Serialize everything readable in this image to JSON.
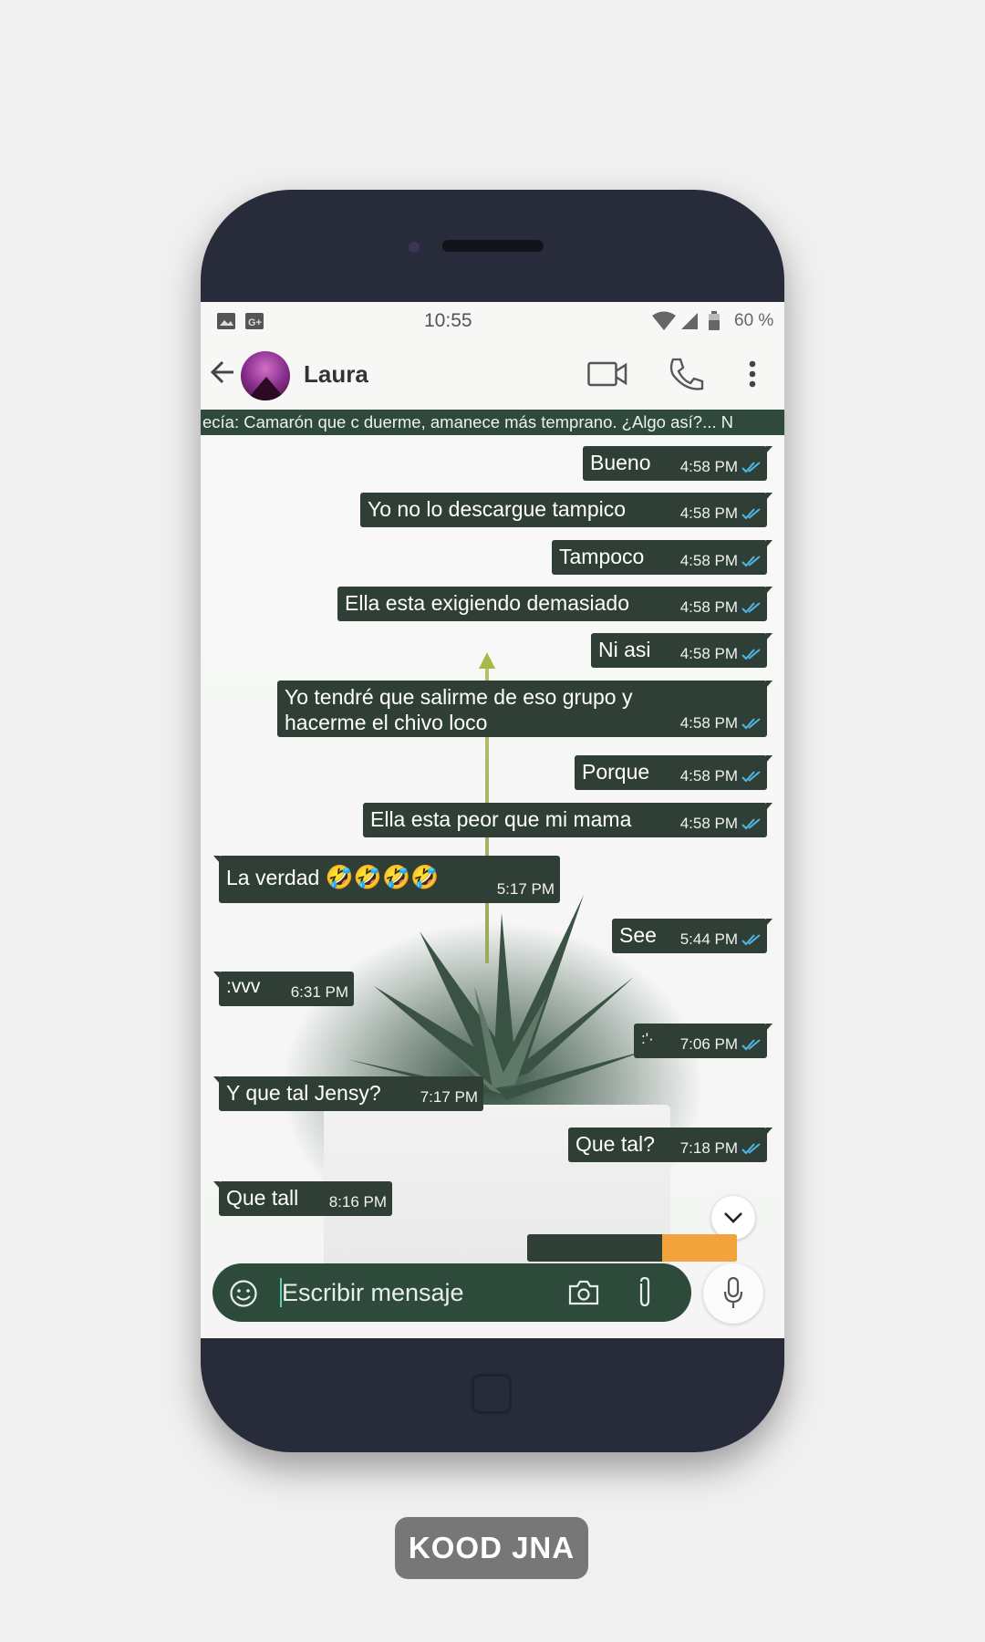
{
  "status_bar": {
    "time": "10:55",
    "battery": "60 %"
  },
  "header": {
    "contact_name": "Laura"
  },
  "marquee_text": "ecía: Camarón que c duerme, amanece más temprano. ¿Algo así?... N",
  "messages": [
    {
      "text": "Bueno",
      "time": "4:58 PM",
      "dir": "out"
    },
    {
      "text": "Yo no lo descargue tampico",
      "time": "4:58 PM",
      "dir": "out"
    },
    {
      "text": "Tampoco",
      "time": "4:58 PM",
      "dir": "out"
    },
    {
      "text": "Ella esta exigiendo demasiado",
      "time": "4:58 PM",
      "dir": "out"
    },
    {
      "text": "Ni asi",
      "time": "4:58 PM",
      "dir": "out"
    },
    {
      "text": "Yo tendré que salirme de eso grupo y",
      "text2": "hacerme el chivo loco",
      "time": "4:58 PM",
      "dir": "out"
    },
    {
      "text": "Porque",
      "time": "4:58 PM",
      "dir": "out"
    },
    {
      "text": "Ella esta peor que mi mama",
      "time": "4:58 PM",
      "dir": "out"
    },
    {
      "text": "La verdad",
      "emoji": "🤣🤣🤣🤣",
      "time": "5:17 PM",
      "dir": "in"
    },
    {
      "text": "See",
      "time": "5:44 PM",
      "dir": "out"
    },
    {
      "text": ":vvv",
      "time": "6:31 PM",
      "dir": "in"
    },
    {
      "text": ":'·",
      "time": "7:06 PM",
      "dir": "out"
    },
    {
      "text": "Y que tal Jensy?",
      "time": "7:17 PM",
      "dir": "in"
    },
    {
      "text": "Que tal?",
      "time": "7:18 PM",
      "dir": "out"
    },
    {
      "text": "Que tall",
      "time": "8:16 PM",
      "dir": "in"
    }
  ],
  "input": {
    "placeholder": "Escribir mensaje"
  },
  "brand": "KOOD JNA",
  "colors": {
    "bubble": "#2f3f35",
    "read_tick": "#4fb6e8",
    "accent": "#2e4a3b"
  }
}
